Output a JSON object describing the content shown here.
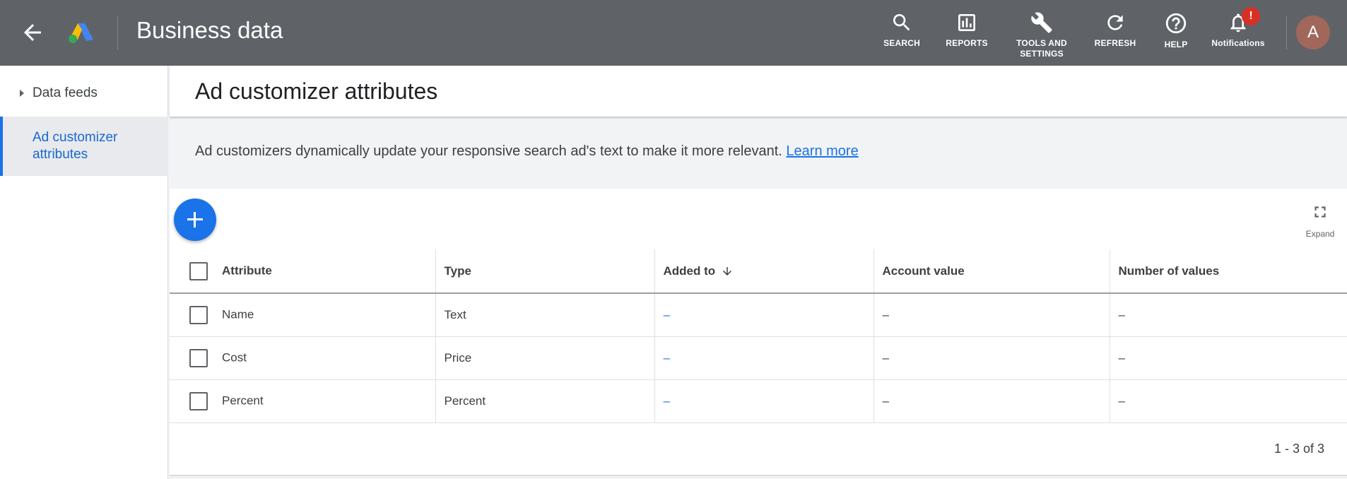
{
  "header": {
    "app_title": "Business data",
    "tools": [
      {
        "icon": "search-icon",
        "label": "SEARCH"
      },
      {
        "icon": "reports-icon",
        "label": "REPORTS"
      },
      {
        "icon": "wrench-icon",
        "label": "TOOLS AND SETTINGS"
      },
      {
        "icon": "refresh-icon",
        "label": "REFRESH"
      },
      {
        "icon": "help-icon",
        "label": "HELP"
      },
      {
        "icon": "bell-icon",
        "label": "Notifications"
      }
    ],
    "notification_badge": "!",
    "avatar_initial": "A"
  },
  "sidebar": {
    "items": [
      {
        "label": "Data feeds",
        "active": false
      },
      {
        "label": "Ad customizer attributes",
        "active": true
      }
    ]
  },
  "main": {
    "page_title": "Ad customizer attributes",
    "info_text": "Ad customizers dynamically update your responsive search ad's text to make it more relevant.",
    "learn_more": "Learn more",
    "expand_label": "Expand",
    "table": {
      "columns": [
        "Attribute",
        "Type",
        "Added to",
        "Account value",
        "Number of values"
      ],
      "rows": [
        {
          "attribute": "Name",
          "type": "Text",
          "added_to": "–",
          "account_value": "–",
          "num_values": "–"
        },
        {
          "attribute": "Cost",
          "type": "Price",
          "added_to": "–",
          "account_value": "–",
          "num_values": "–"
        },
        {
          "attribute": "Percent",
          "type": "Percent",
          "added_to": "–",
          "account_value": "–",
          "num_values": "–"
        }
      ]
    },
    "pagination": "1 - 3 of 3"
  },
  "colors": {
    "topbar": "#5f6368",
    "accent": "#1a73e8",
    "notification_badge": "#d93025",
    "avatar": "#a1675a"
  }
}
